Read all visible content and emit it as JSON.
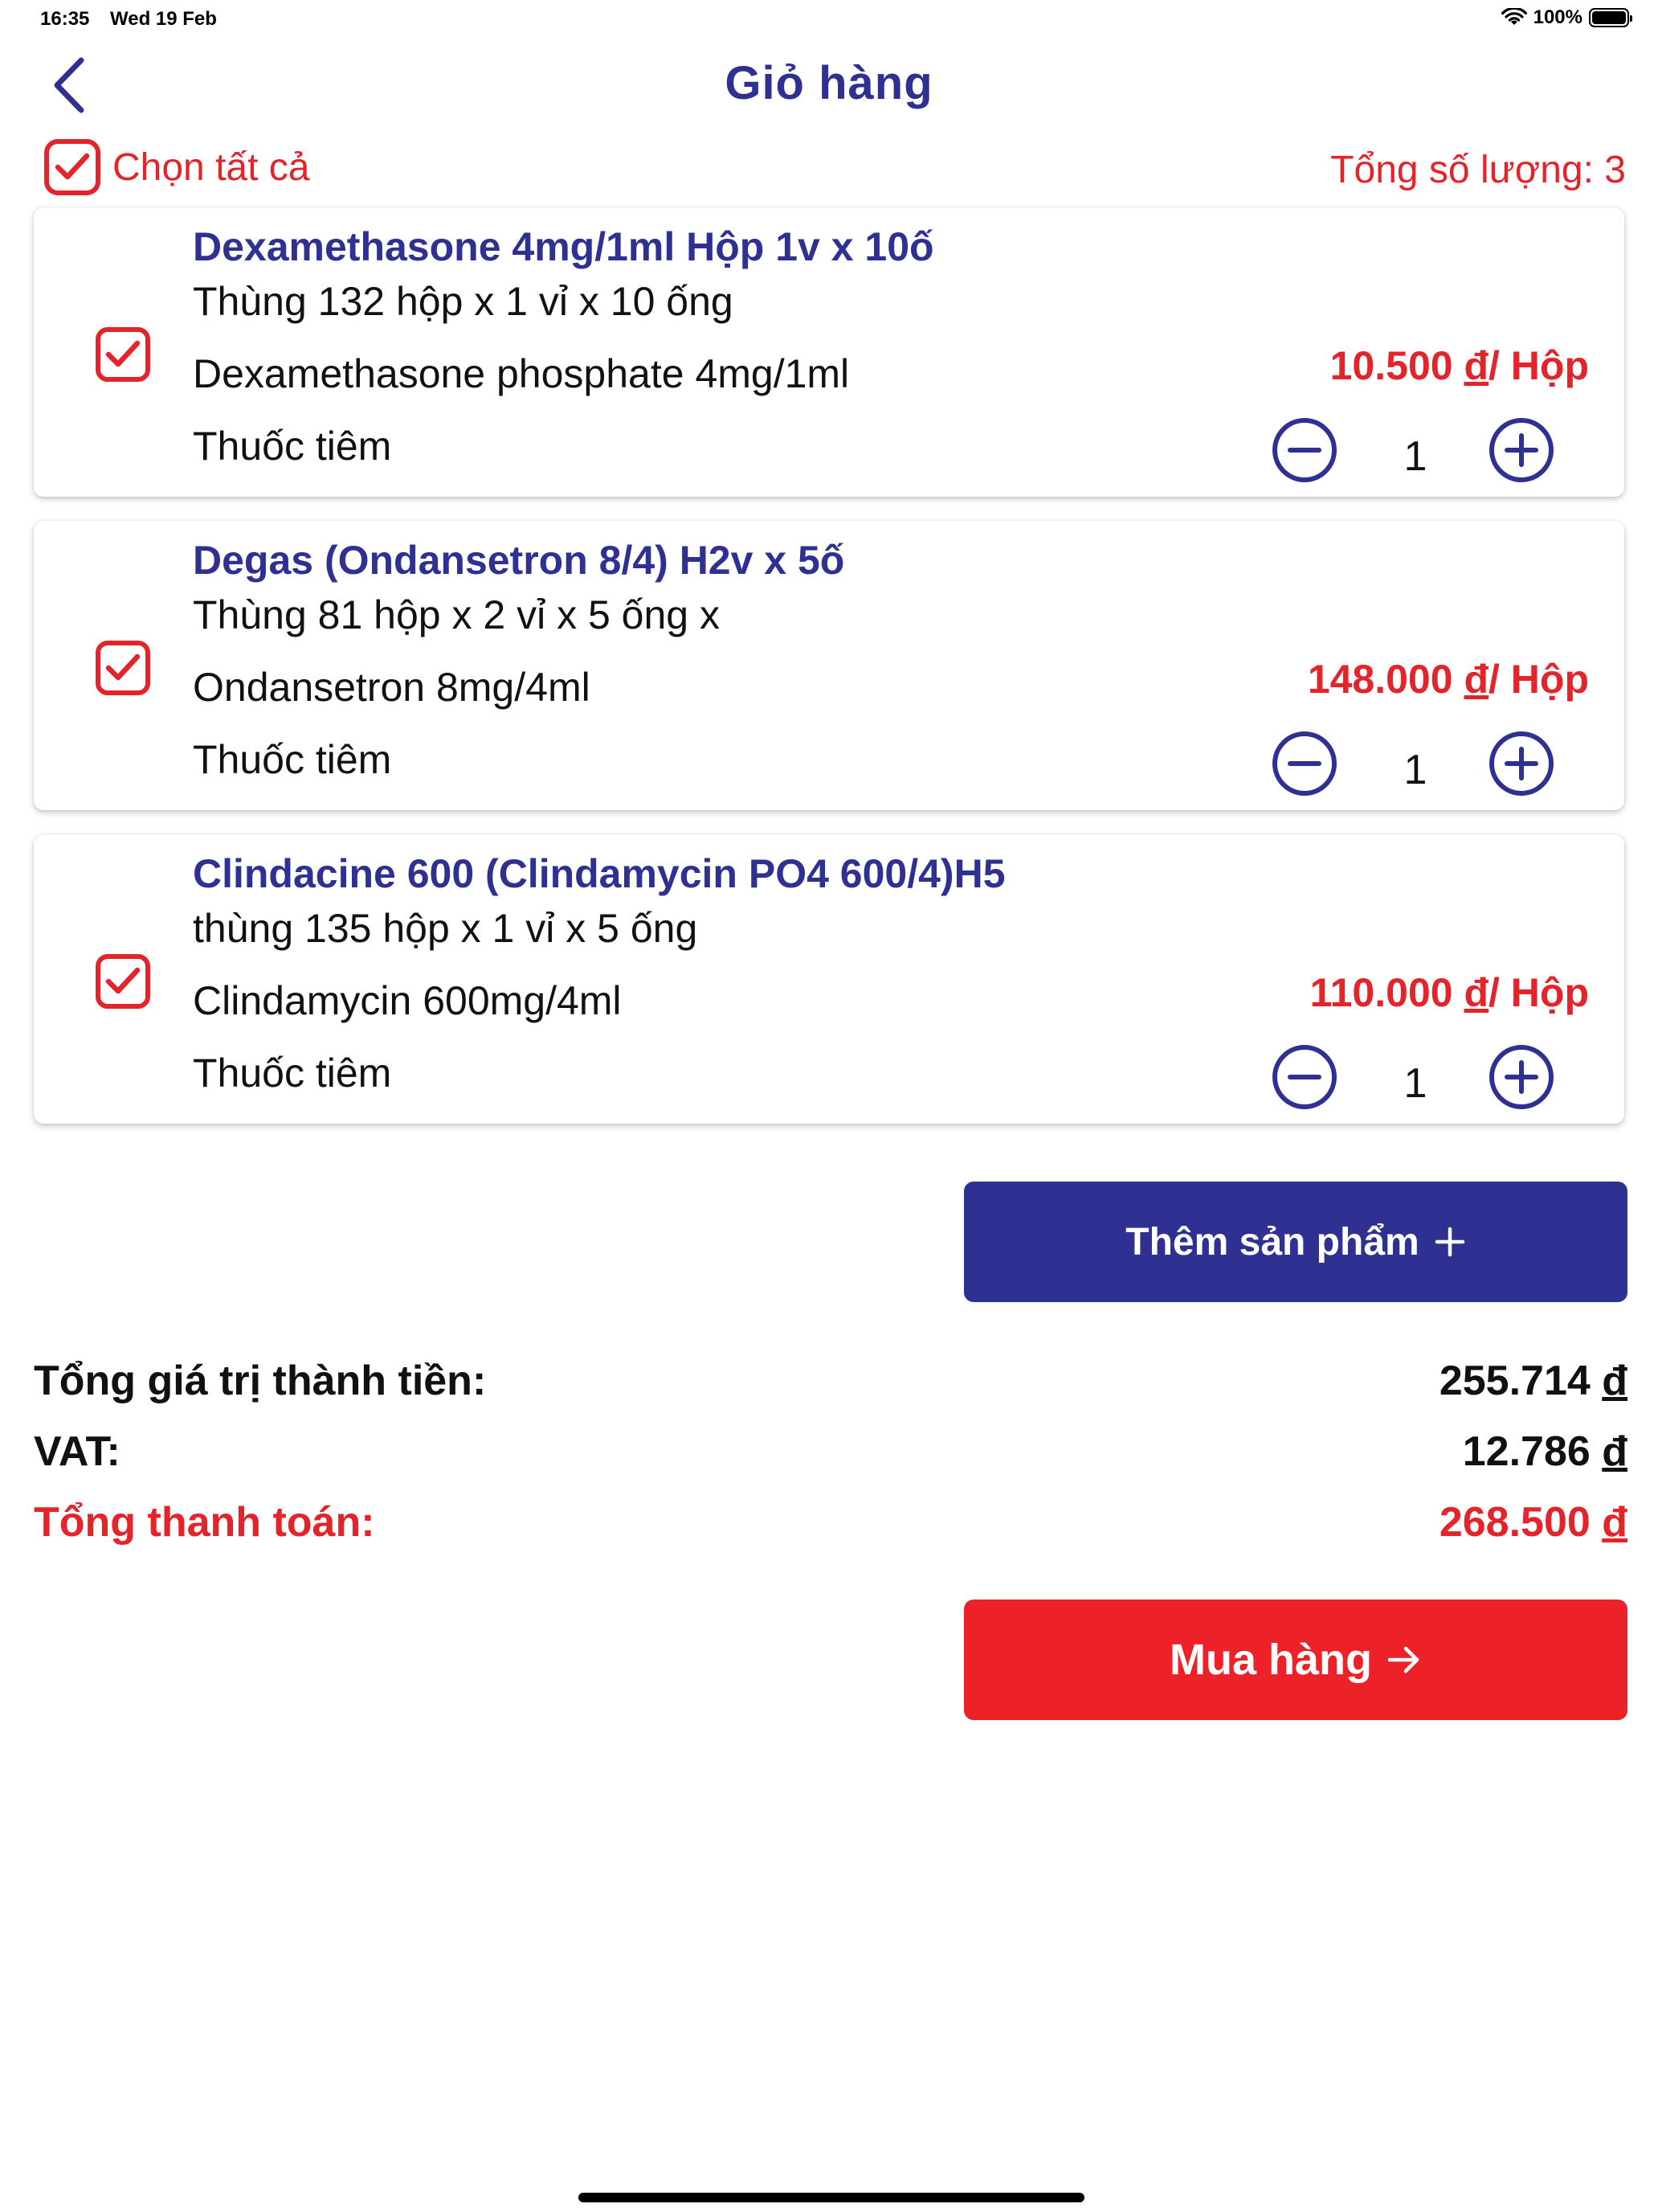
{
  "status_bar": {
    "time": "16:35",
    "date": "Wed 19 Feb",
    "battery": "100%"
  },
  "header": {
    "title": "Giỏ hàng",
    "back_icon": "chevron-left-icon"
  },
  "select_all": {
    "label": "Chọn tất cả",
    "checked": true
  },
  "total_quantity": "Tổng số lượng: 3",
  "items": [
    {
      "name": "Dexamethasone 4mg/1ml Hộp 1v x 10ố",
      "packaging": "Thùng 132 hộp x 1 vỉ x 10 ống",
      "ingredient": "Dexamethasone phosphate 4mg/1ml",
      "category": "Thuốc tiêm",
      "price": "10.500",
      "currency": "đ",
      "unit": "/ Hộp",
      "quantity": "1",
      "checked": true
    },
    {
      "name": "Degas (Ondansetron 8/4) H2v x 5ố",
      "packaging": "Thùng 81 hộp x 2 vỉ x 5 ống x",
      "ingredient": "Ondansetron 8mg/4ml",
      "category": "Thuốc tiêm",
      "price": "148.000",
      "currency": "đ",
      "unit": "/ Hộp",
      "quantity": "1",
      "checked": true
    },
    {
      "name": "Clindacine 600 (Clindamycin PO4 600/4)H5",
      "packaging": "thùng 135 hộp x 1 vỉ x 5 ống",
      "ingredient": "Clindamycin 600mg/4ml",
      "category": "Thuốc tiêm",
      "price": "110.000",
      "currency": "đ",
      "unit": "/ Hộp",
      "quantity": "1",
      "checked": true
    }
  ],
  "add_product": {
    "label": "Thêm sản phẩm",
    "icon": "plus-icon"
  },
  "summary": {
    "subtotal_label": "Tổng giá trị thành tiền:",
    "subtotal_value": "255.714",
    "vat_label": "VAT:",
    "vat_value": "12.786",
    "total_label": "Tổng thanh toán:",
    "total_value": "268.500",
    "currency": "đ"
  },
  "buy": {
    "label": "Mua hàng",
    "icon": "arrow-right-icon"
  },
  "colors": {
    "primary": "#2e3192",
    "accent": "#e3242b",
    "button_red": "#ec2228"
  }
}
